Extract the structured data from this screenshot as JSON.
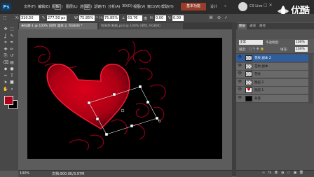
{
  "menubar": {
    "app_logo": "Ps",
    "items": [
      "文件(F)",
      "编辑(E)",
      "图像(I)",
      "图层(L)",
      "选择(S)",
      "滤镜(T)",
      "分析(A)",
      "3D(D)",
      "视图(V)",
      "窗口(W)",
      "帮助(H)"
    ],
    "workspace_button": "基本功能",
    "design_label": "设计",
    "more_label": "»",
    "cslive_label": "CS Live",
    "window_controls": "–  ▢  ✕"
  },
  "watermark": {
    "text": "优酷",
    "icon": "youku-logo-icon"
  },
  "options_bar": {
    "x_label": "X:",
    "x_value": "310.50 px",
    "y_label": "Y:",
    "y_value": "277.50 px",
    "w_label": "W:",
    "w_value": "75.85%",
    "h_label": "H:",
    "h_value": "75.85%",
    "angle_label": "∠",
    "angle_value": "63.76",
    "hskew_label": "H:",
    "hskew_value": "0.00",
    "vskew_label": "V:",
    "vskew_value": "0.00",
    "interp_label": "度"
  },
  "tabs": [
    {
      "label": "未标题-1 @ 100% (花纹 副本 2, RGB/8) *",
      "active": true
    },
    {
      "label": "有关热(粘帖,psd @ 100% (花纹, RGB/8)",
      "active": false
    }
  ],
  "status": {
    "zoom": "100%",
    "doc_info": "文档:900.0K/3.97M"
  },
  "colors": {
    "foreground": "#b0001a",
    "background": "#000000",
    "heart": "#c8001a"
  },
  "panel_tabs": [
    "图层",
    "通道",
    "路径"
  ],
  "layers_panel": {
    "blend_mode": "正常",
    "opacity_label": "不透明度:",
    "opacity_value": "100%",
    "lock_label": "锁定:",
    "fill_label": "填充:",
    "fill_value": "100%",
    "layers": [
      {
        "name": "花纹 副本 2",
        "selected": true,
        "thumb": "checker"
      },
      {
        "name": "花纹 副本",
        "selected": false,
        "thumb": "checker"
      },
      {
        "name": "花纹",
        "selected": false,
        "thumb": "checker"
      },
      {
        "name": "图层 2",
        "selected": false,
        "thumb": "checker"
      },
      {
        "name": "图层 1",
        "selected": false,
        "thumb": "heart"
      },
      {
        "name": "背景",
        "selected": false,
        "thumb": "black"
      }
    ]
  },
  "icons": {
    "tools": [
      "move-tool-icon",
      "marquee-tool-icon",
      "lasso-tool-icon",
      "quick-select-tool-icon",
      "crop-tool-icon",
      "eyedropper-tool-icon",
      "healing-brush-icon",
      "brush-tool-icon",
      "clone-stamp-icon",
      "history-brush-icon",
      "eraser-tool-icon",
      "gradient-tool-icon",
      "blur-tool-icon",
      "dodge-tool-icon",
      "pen-tool-icon",
      "type-tool-icon",
      "path-select-icon",
      "shape-tool-icon",
      "hand-tool-icon",
      "zoom-tool-icon"
    ]
  }
}
